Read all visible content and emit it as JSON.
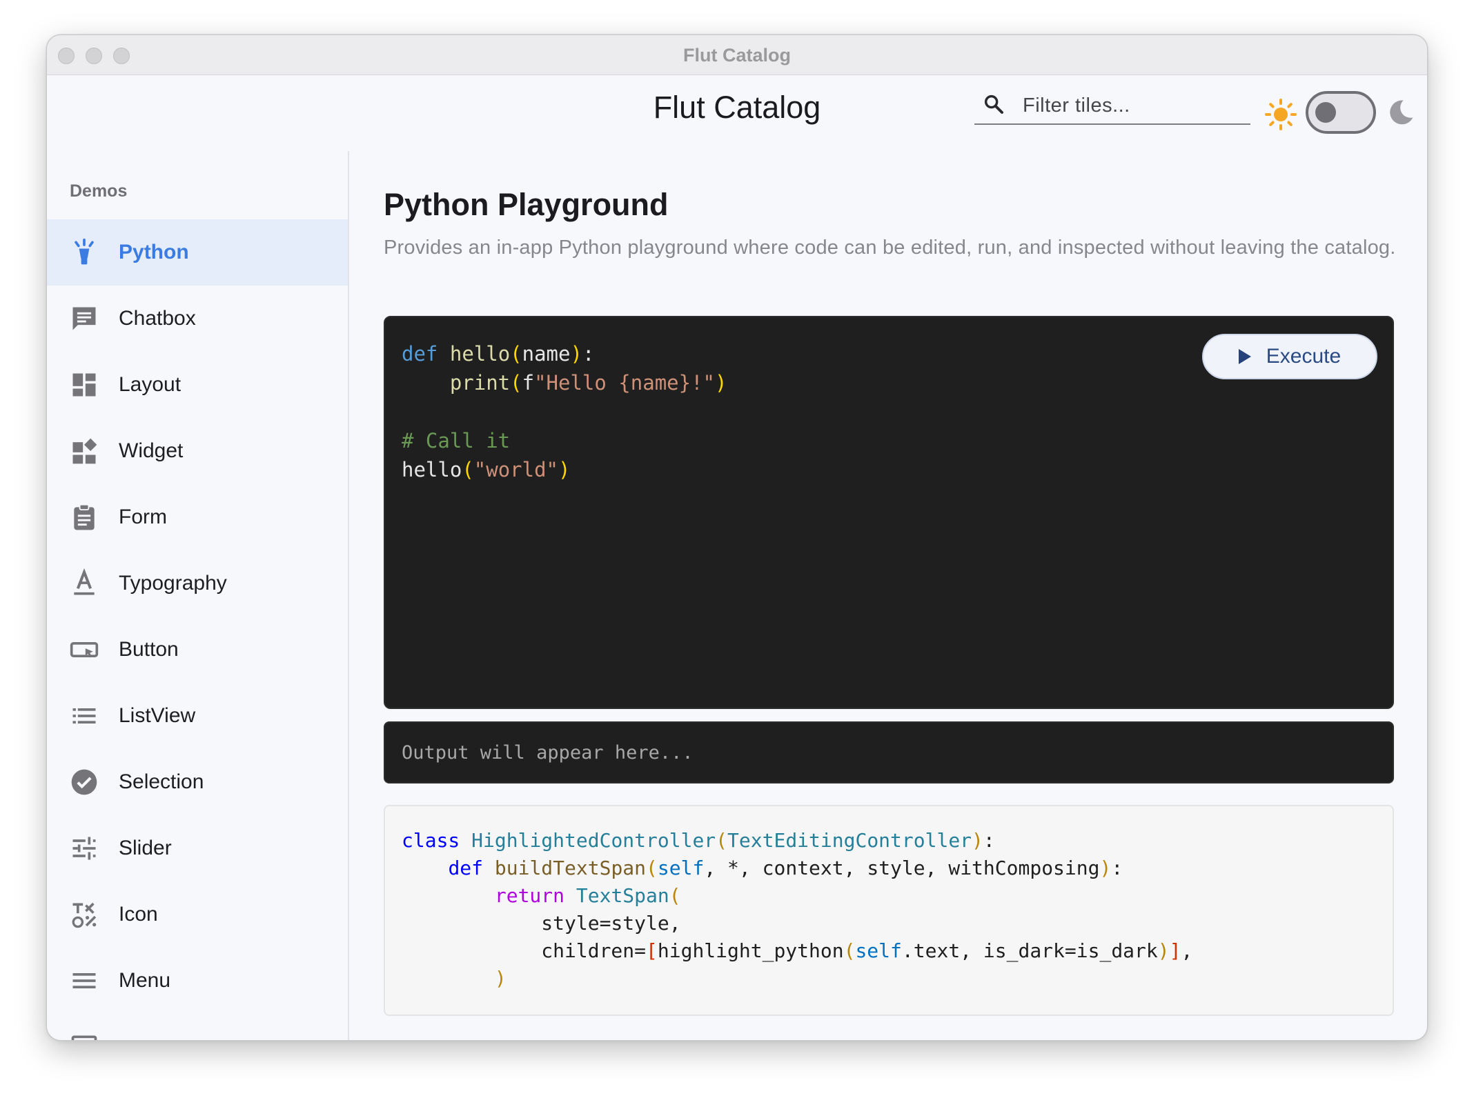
{
  "window": {
    "title": "Flut Catalog"
  },
  "appbar": {
    "title": "Flut Catalog",
    "search_placeholder": "Filter tiles...",
    "theme_toggle_on": false,
    "icons": [
      "search-icon",
      "sun-icon",
      "moon-icon"
    ]
  },
  "sidebar": {
    "section": "Demos",
    "items": [
      {
        "label": "Python",
        "icon": "python-icon",
        "active": true
      },
      {
        "label": "Chatbox",
        "icon": "chat-icon"
      },
      {
        "label": "Layout",
        "icon": "dashboard-icon"
      },
      {
        "label": "Widget",
        "icon": "widgets-icon"
      },
      {
        "label": "Form",
        "icon": "clipboard-icon"
      },
      {
        "label": "Typography",
        "icon": "text-format-icon"
      },
      {
        "label": "Button",
        "icon": "button-icon"
      },
      {
        "label": "ListView",
        "icon": "list-icon"
      },
      {
        "label": "Selection",
        "icon": "check-circle-icon"
      },
      {
        "label": "Slider",
        "icon": "tune-icon"
      },
      {
        "label": "Icon",
        "icon": "symbols-icon"
      },
      {
        "label": "Menu",
        "icon": "menu-icon"
      }
    ]
  },
  "main": {
    "title": "Python Playground",
    "description": "Provides an in-app Python playground where code can be edited, run, and inspected without leaving the catalog.",
    "editor": {
      "code_lines": [
        "def hello(name):",
        "    print(f\"Hello {name}!\")",
        "",
        "# Call it",
        "hello(\"world\")"
      ]
    },
    "execute_label": "Execute",
    "output_placeholder": "Output will appear here...",
    "snippet_lines": [
      "class HighlightedController(TextEditingController):",
      "    def buildTextSpan(self, *, context, style, withComposing):",
      "        return TextSpan(",
      "            style=style,",
      "            children=[highlight_python(self.text, is_dark=is_dark)],",
      "        )"
    ]
  },
  "colors": {
    "accent": "#3a7ce2",
    "active_bg": "#e5edfb",
    "editor_bg": "#1f1f1f",
    "sun": "#f5a623"
  }
}
